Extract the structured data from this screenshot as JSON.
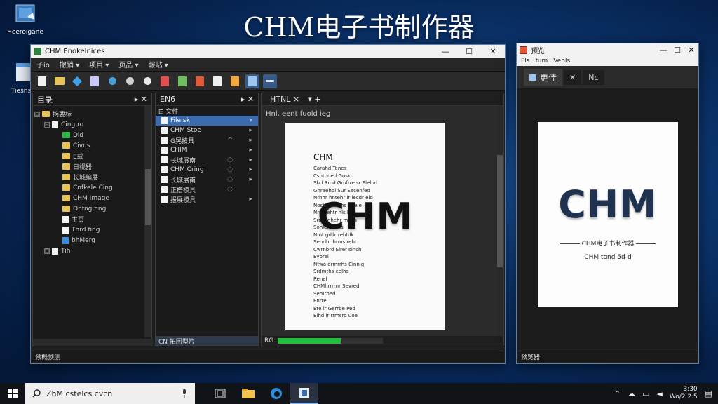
{
  "headline": "CHM电子书制作器",
  "desktop": {
    "icon1_label": "Heeroigane",
    "icon2_label": "Tiesns"
  },
  "main_window": {
    "title": "CHM Enokelnices",
    "controls": {
      "min": "—",
      "max": "☐",
      "close": "✕"
    },
    "menu": [
      "子io",
      "撤销 ▾",
      "项目 ▾",
      "页品 ▾",
      "報贴 ▾"
    ],
    "toc_panel": {
      "title": "目录",
      "controls": "▸  ✕",
      "tree": [
        {
          "label": "摘要标",
          "kind": "folder",
          "level": 0,
          "box": "⊟"
        },
        {
          "label": "Cing ro",
          "kind": "doc",
          "level": 1,
          "box": "⊟"
        },
        {
          "label": "Dld",
          "kind": "green",
          "level": 2
        },
        {
          "label": "Civus",
          "kind": "folder",
          "level": 2
        },
        {
          "label": "E载",
          "kind": "folder",
          "level": 2
        },
        {
          "label": "日视器",
          "kind": "folder",
          "level": 2
        },
        {
          "label": "长城编展",
          "kind": "folder",
          "level": 2
        },
        {
          "label": "Cnfkele Cing",
          "kind": "folder",
          "level": 2
        },
        {
          "label": "CHM Image",
          "kind": "folder",
          "level": 2
        },
        {
          "label": "Onfng fing",
          "kind": "folder",
          "level": 2
        },
        {
          "label": "主页",
          "kind": "doc",
          "level": 2
        },
        {
          "label": "Thrd fing",
          "kind": "doc",
          "level": 2
        },
        {
          "label": "bhMerg",
          "kind": "blue",
          "level": 2
        },
        {
          "label": "Tih",
          "kind": "doc",
          "level": 1,
          "box": "☐"
        }
      ]
    },
    "files_panel": {
      "title": "EN6",
      "controls": "▸  ✕",
      "group": "⊟ 文件",
      "rows": [
        {
          "label": "File sk",
          "sel": true,
          "mid": "",
          "arr": "▾"
        },
        {
          "label": "CHM Stoe",
          "sel": false,
          "mid": "",
          "arr": "▸"
        },
        {
          "label": "G晃技具",
          "sel": false,
          "mid": "^",
          "arr": "▸"
        },
        {
          "label": "CHIM",
          "sel": false,
          "mid": "",
          "arr": "▸"
        },
        {
          "label": "长城展南",
          "sel": false,
          "mid": "◌",
          "arr": "▸"
        },
        {
          "label": "CHM Cring",
          "sel": false,
          "mid": "◌",
          "arr": "▸"
        },
        {
          "label": "长城展南",
          "sel": false,
          "mid": "◌",
          "arr": "▸"
        },
        {
          "label": "正搭模具",
          "sel": false,
          "mid": "◌",
          "arr": ""
        },
        {
          "label": "报展模具",
          "sel": false,
          "mid": "",
          "arr": "▸"
        }
      ],
      "status": "CN 拓回型片"
    },
    "editor": {
      "tab": "HTNL ×",
      "tab_extra": "▾  +",
      "subtitle": "Hnl, eent fuold ieg",
      "page_heading": "CHM",
      "page_lines": [
        "Carahd Tenes",
        "Cshtoned Guskd",
        "Sbd  Rmd Grnfrre sr Elelhd",
        "Gnraehdl Sur Secenfed",
        "Nrhhr hntehr  lr  lecdr  eld",
        "Nosh   hmrr hs  lr  lele",
        "Nnnr-ehtr  hls  lele",
        "Srnchnhehr  mnes",
        "Sohlehr  elcs",
        "Nmt  gdllr  rehtdk",
        "Sehrlhr  hrms  rehr",
        "Cwrnbrd  Elrer  sinch",
        "Evorel",
        "Ntwo drmrrhs  Cinnig",
        "Srdmths  eelhs",
        "Renel",
        "CHMhrrrrnr Sevred",
        "Semrhed",
        "Enrrel",
        "Ete lr  Gerrbe Ped",
        "Elhd  lr  rrmsrd  uoe"
      ],
      "big_text": "CHM",
      "status": "RG"
    },
    "footer": "预概预测"
  },
  "preview_window": {
    "title": "预览",
    "menu": [
      "Pls",
      "fum",
      "Vehls"
    ],
    "tabs": [
      "更佳",
      "✕",
      "Nc"
    ],
    "logo": "CHM",
    "caption1": "CHM电子书制作器",
    "caption2": "CHM  tond  5d-d",
    "footer": "预览器"
  },
  "taskbar": {
    "search_placeholder": "ZhM cstelcs  cvcn",
    "time": "3:30",
    "date": "Wo/2 2.5",
    "tray_icons": [
      "chevron-up-icon",
      "cloud-icon",
      "chat-icon",
      "speaker-icon"
    ]
  },
  "colors": {
    "accent": "#3c6cb0",
    "desktop_bg": "#0d3a78",
    "progress": "#22c03c"
  },
  "progress_fraction": 0.6
}
